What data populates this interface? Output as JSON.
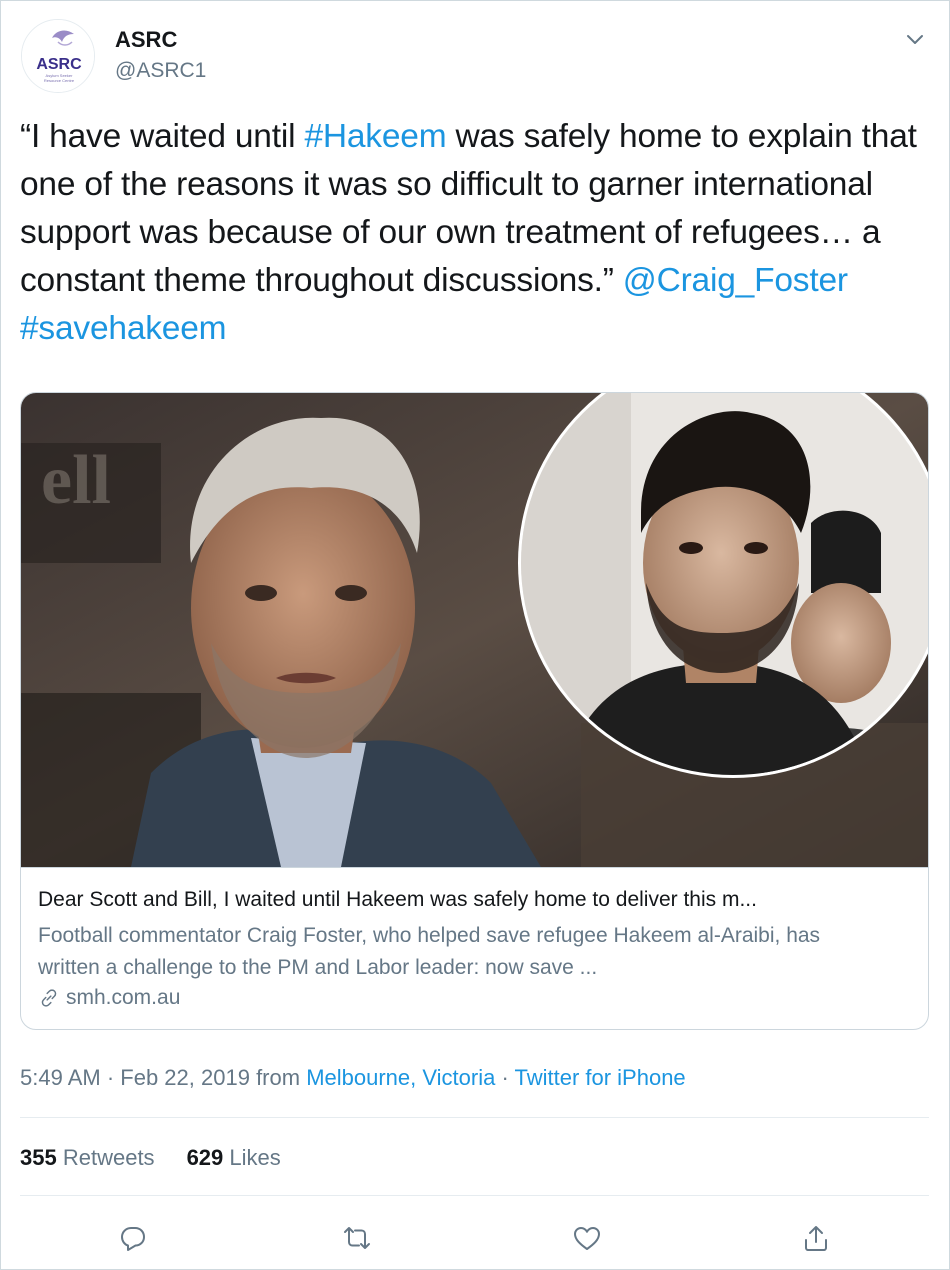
{
  "header": {
    "display_name": "ASRC",
    "handle": "@ASRC1",
    "avatar_logo_text": "ASRC",
    "avatar_logo_subtext": "Asylum Seeker Resource Centre"
  },
  "tweet": {
    "text_part1": "“I have waited until ",
    "hashtag1": "#Hakeem",
    "text_part2": " was safely home to explain that one of the reasons it was so difficult to garner international support was because of our own treatment of refugees… a constant theme throughout discussions.” ",
    "mention": "@Craig_Foster",
    "space": " ",
    "hashtag2": "#savehakeem"
  },
  "card": {
    "title": "Dear Scott and Bill, I waited until Hakeem was safely home to deliver this m...",
    "description": "Football commentator Craig Foster, who helped save refugee Hakeem al-Araibi, has written a challenge to the PM and Labor leader: now save ...",
    "domain": "smh.com.au",
    "image_caption": "Photo of Craig Foster with inset circle photo of Hakeem al-Araibi"
  },
  "meta": {
    "time": "5:49 AM",
    "dot1": " · ",
    "date": "Feb 22, 2019",
    "from": " from ",
    "location": "Melbourne, Victoria",
    "dot2": " · ",
    "source": "Twitter for iPhone"
  },
  "stats": {
    "retweets_count": "355",
    "retweets_label": "Retweets",
    "likes_count": "629",
    "likes_label": "Likes"
  },
  "actions": {
    "reply_icon": "reply-icon",
    "retweet_icon": "retweet-icon",
    "like_icon": "heart-icon",
    "share_icon": "share-icon"
  },
  "colors": {
    "link": "#1b95e0",
    "secondary": "#657786",
    "primary_text": "#14171a",
    "border": "#ccd6dd"
  }
}
